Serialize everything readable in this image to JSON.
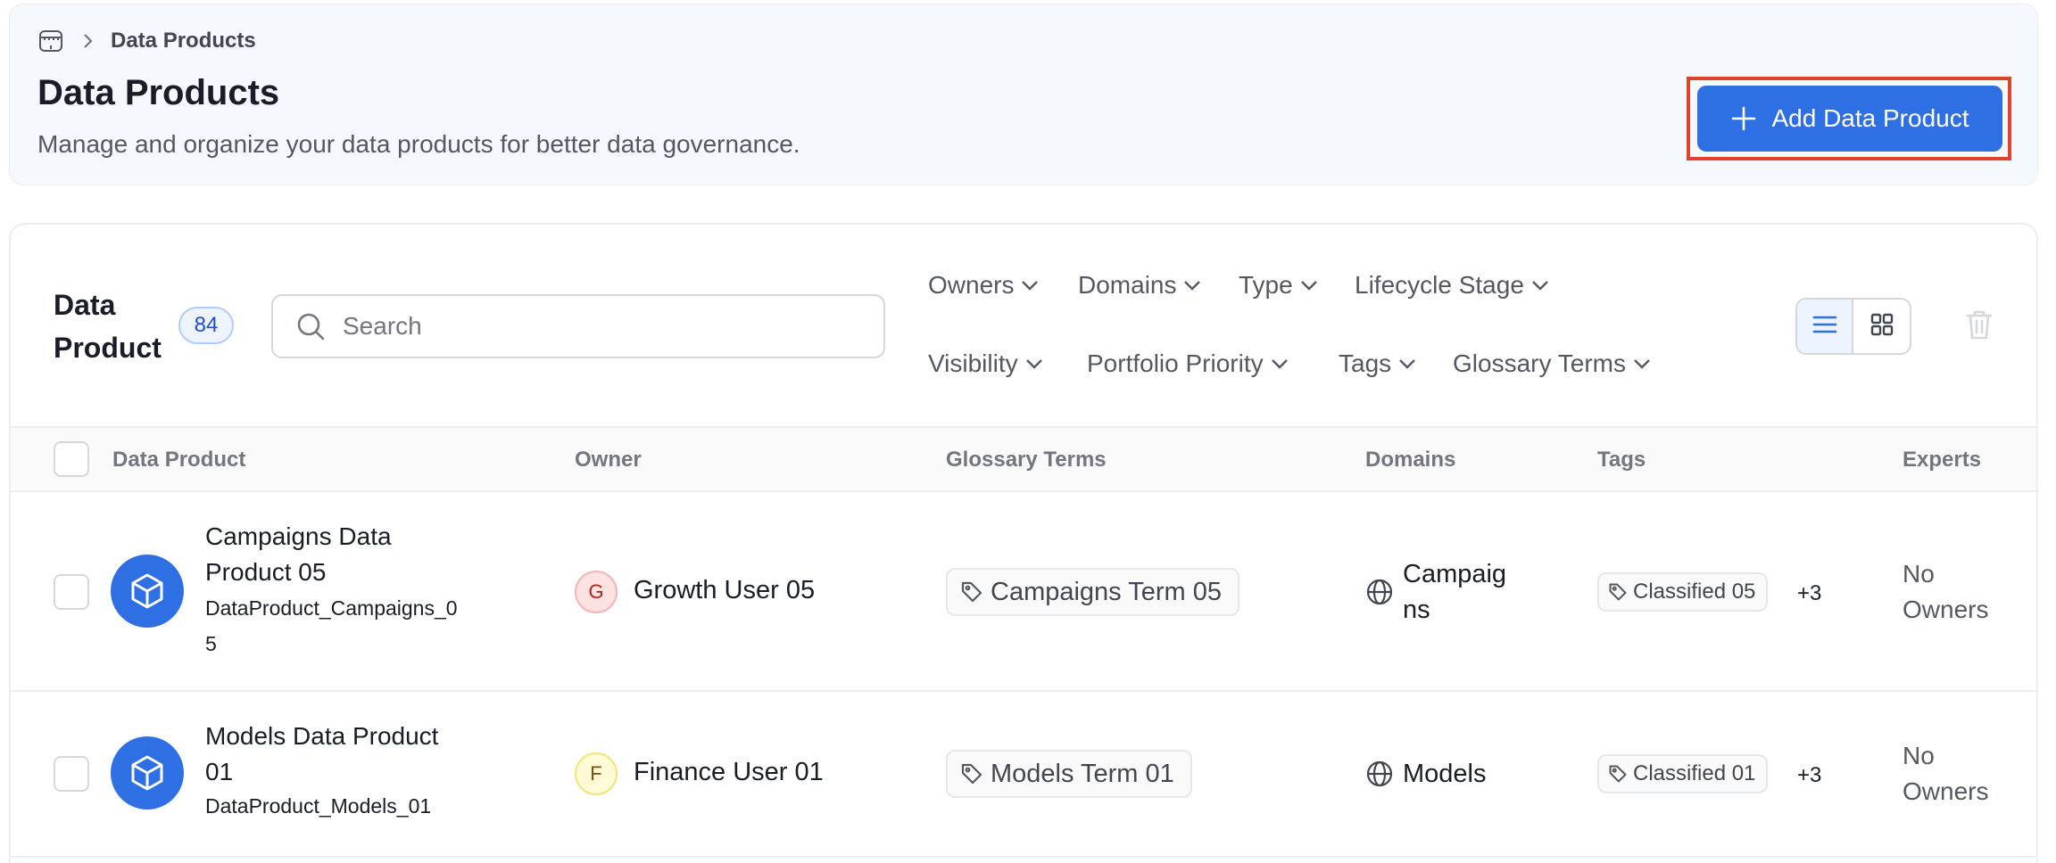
{
  "breadcrumb": {
    "current": "Data Products"
  },
  "header": {
    "title": "Data Products",
    "description": "Manage and organize your data products for better data governance.",
    "add_button_label": "Add Data Product"
  },
  "toolbar": {
    "section_title_line1": "Data",
    "section_title_line2": "Product",
    "count": "84",
    "search_placeholder": "Search",
    "filters_row1": [
      "Owners",
      "Domains",
      "Type",
      "Lifecycle Stage"
    ],
    "filters_row2": [
      "Visibility",
      "Portfolio Priority",
      "Tags",
      "Glossary Terms"
    ],
    "active_view": "list"
  },
  "table": {
    "columns": [
      "Data Product",
      "Owner",
      "Glossary Terms",
      "Domains",
      "Tags",
      "Experts"
    ],
    "rows": [
      {
        "name_line1": "Campaigns Data",
        "name_line2": "Product 05",
        "fqn_line1": "DataProduct_Campaigns_0",
        "fqn_line2": "5",
        "owner_initial": "G",
        "owner": "Growth User 05",
        "glossary_term": "Campaigns Term 05",
        "domain_line1": "Campaig",
        "domain_line2": "ns",
        "tag": "Classified 05",
        "tag_more": "+3",
        "experts_line1": "No",
        "experts_line2": "Owners"
      },
      {
        "name_line1": "Models Data Product",
        "name_line2": "01",
        "fqn_line1": "DataProduct_Models_01",
        "owner_initial": "F",
        "owner": "Finance User 01",
        "glossary_term": "Models Term 01",
        "domain_line1": "Models",
        "tag": "Classified 01",
        "tag_more": "+3",
        "experts_line1": "No",
        "experts_line2": "Owners"
      }
    ]
  },
  "colors": {
    "primary": "#2f6fe4",
    "highlight_frame": "#e0432b",
    "avatar_g_bg": "#fde2e2",
    "avatar_g_fg": "#b42318",
    "avatar_f_bg": "#fefbd6",
    "avatar_f_fg": "#854a0e"
  }
}
